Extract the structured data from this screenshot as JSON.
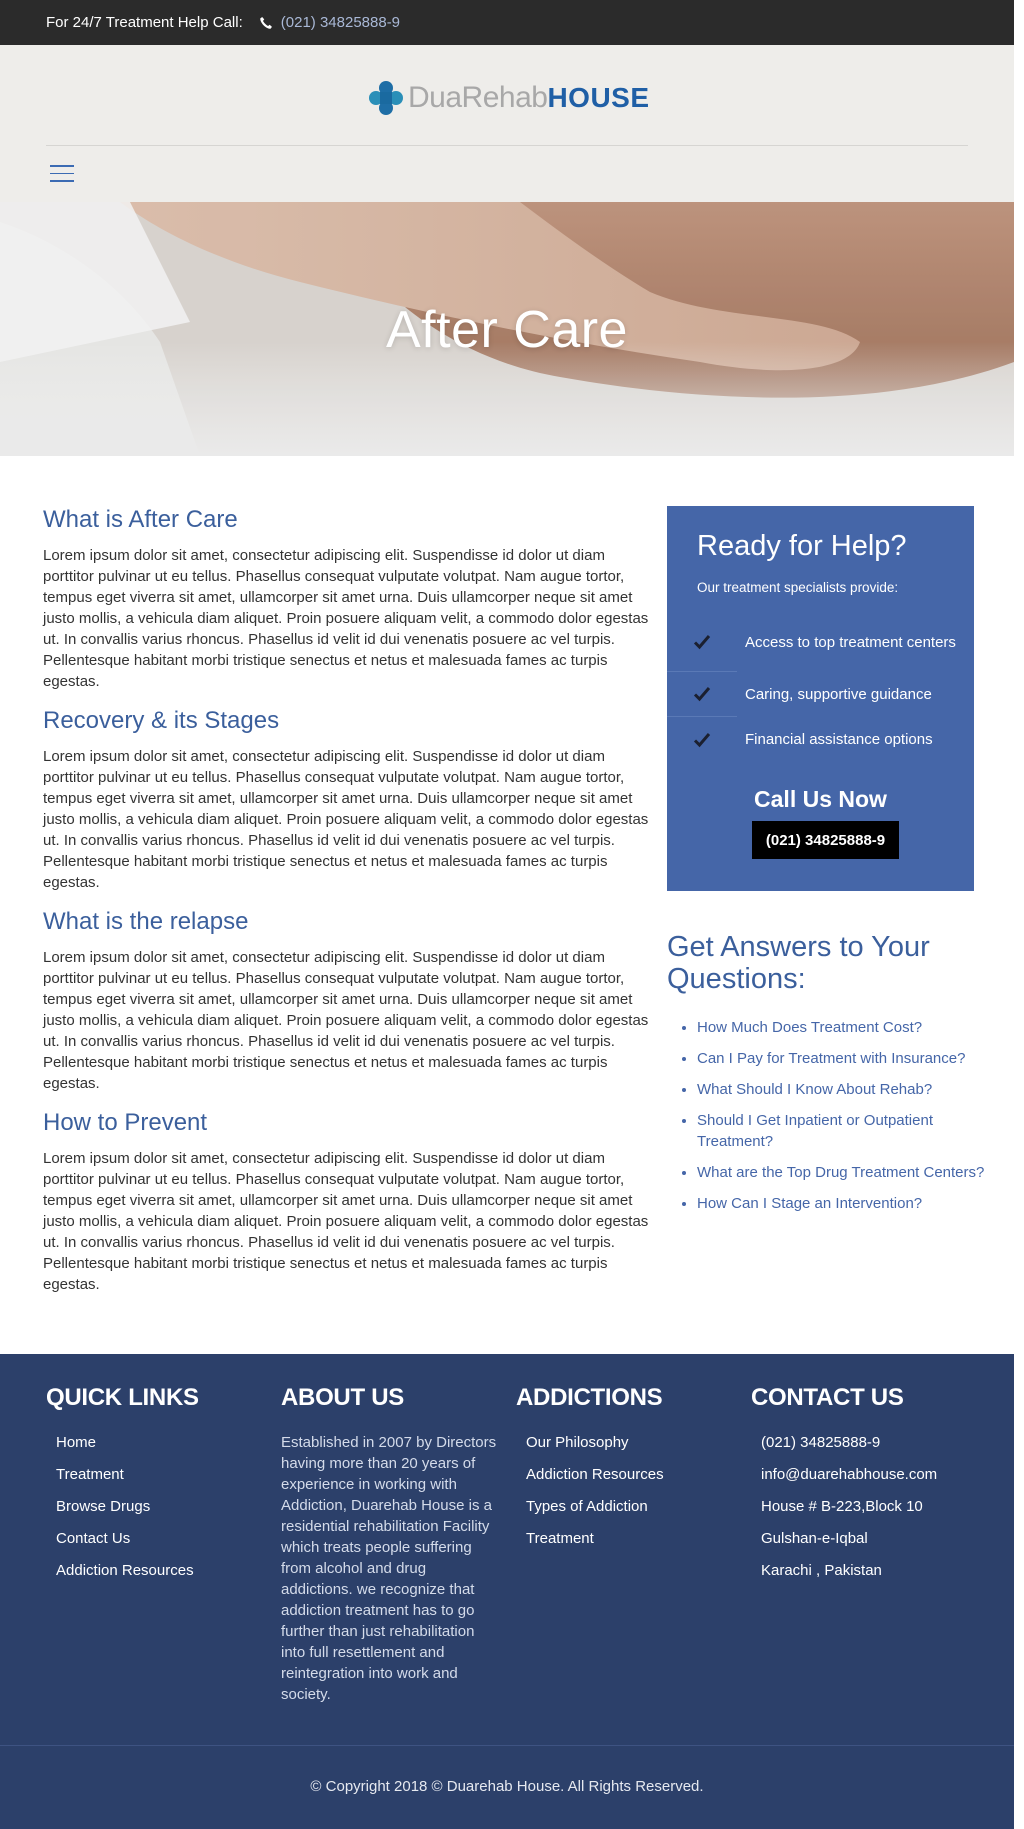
{
  "topbar": {
    "help_label": "For 24/7 Treatment Help Call:",
    "phone_icon": "phone-icon",
    "phone": "(021) 34825888-9"
  },
  "header": {
    "logo_part1": "DuaRehab",
    "logo_part2": "HOUSE",
    "menu_icon": "hamburger-menu-icon",
    "colors": {
      "background": "#eeedea",
      "accent": "#1f5fa6"
    }
  },
  "hero": {
    "title": "After Care"
  },
  "article": {
    "sections": [
      {
        "heading": "What is After Care",
        "body": "Lorem ipsum dolor sit amet, consectetur adipiscing elit. Suspendisse id dolor ut diam porttitor pulvinar ut eu tellus. Phasellus consequat vulputate volutpat. Nam augue tortor, tempus eget viverra sit amet, ullamcorper sit amet urna. Duis ullamcorper neque sit amet justo mollis, a vehicula diam aliquet. Proin posuere aliquam velit, a commodo dolor egestas ut. In convallis varius rhoncus. Phasellus id velit id dui venenatis posuere ac vel turpis. Pellentesque habitant morbi tristique senectus et netus et malesuada fames ac turpis egestas."
      },
      {
        "heading": "Recovery & its Stages",
        "body": "Lorem ipsum dolor sit amet, consectetur adipiscing elit. Suspendisse id dolor ut diam porttitor pulvinar ut eu tellus. Phasellus consequat vulputate volutpat. Nam augue tortor, tempus eget viverra sit amet, ullamcorper sit amet urna. Duis ullamcorper neque sit amet justo mollis, a vehicula diam aliquet. Proin posuere aliquam velit, a commodo dolor egestas ut. In convallis varius rhoncus. Phasellus id velit id dui venenatis posuere ac vel turpis. Pellentesque habitant morbi tristique senectus et netus et malesuada fames ac turpis egestas."
      },
      {
        "heading": "What is the relapse",
        "body": "Lorem ipsum dolor sit amet, consectetur adipiscing elit. Suspendisse id dolor ut diam porttitor pulvinar ut eu tellus. Phasellus consequat vulputate volutpat. Nam augue tortor, tempus eget viverra sit amet, ullamcorper sit amet urna. Duis ullamcorper neque sit amet justo mollis, a vehicula diam aliquet. Proin posuere aliquam velit, a commodo dolor egestas ut. In convallis varius rhoncus. Phasellus id velit id dui venenatis posuere ac vel turpis. Pellentesque habitant morbi tristique senectus et netus et malesuada fames ac turpis egestas."
      },
      {
        "heading": "How to Prevent",
        "body": "Lorem ipsum dolor sit amet, consectetur adipiscing elit. Suspendisse id dolor ut diam porttitor pulvinar ut eu tellus. Phasellus consequat vulputate volutpat. Nam augue tortor, tempus eget viverra sit amet, ullamcorper sit amet urna. Duis ullamcorper neque sit amet justo mollis, a vehicula diam aliquet. Proin posuere aliquam velit, a commodo dolor egestas ut. In convallis varius rhoncus. Phasellus id velit id dui venenatis posuere ac vel turpis. Pellentesque habitant morbi tristique senectus et netus et malesuada fames ac turpis egestas."
      }
    ]
  },
  "help_box": {
    "title": "Ready for Help?",
    "subtitle": "Our treatment specialists provide:",
    "check_icon": "checkmark-icon",
    "items": [
      "Access to top treatment centers",
      "Caring, supportive guidance",
      "Financial assistance options"
    ],
    "call_label": "Call Us Now",
    "phone": "(021) 34825888-9",
    "colors": {
      "background": "#4566a8",
      "button": "#000000"
    }
  },
  "faq": {
    "title": "Get Answers to Your Questions:",
    "items": [
      "How Much Does Treatment Cost?",
      "Can I Pay for Treatment with Insurance?",
      "What Should I Know About Rehab?",
      "Should I Get Inpatient or Outpatient Treatment?",
      "What are the Top Drug Treatment Centers?",
      "How Can I Stage an Intervention?"
    ]
  },
  "footer": {
    "colors": {
      "background": "#2c406a"
    },
    "quick_links": {
      "title": "QUICK LINKS",
      "items": [
        "Home",
        "Treatment",
        "Browse Drugs",
        "Contact Us",
        "Addiction Resources"
      ]
    },
    "about": {
      "title": "ABOUT US",
      "text": "Established in 2007 by Directors having more than 20 years of experience in working with Addiction, Duarehab House is a residential rehabilitation Facility which treats people suffering from alcohol and drug addictions. we recognize that addiction treatment has to go further than just rehabilitation into full resettlement and reintegration into work and society."
    },
    "addictions": {
      "title": "ADDICTIONS",
      "items": [
        "Our Philosophy",
        "Addiction Resources",
        "Types of Addiction",
        "Treatment"
      ]
    },
    "contact": {
      "title": "CONTACT US",
      "items": [
        "(021) 34825888-9",
        "info@duarehabhouse.com",
        "House # B-223,Block 10",
        "Gulshan-e-Iqbal",
        "Karachi , Pakistan"
      ]
    },
    "copyright": "© Copyright 2018 © Duarehab House. All Rights Reserved."
  }
}
